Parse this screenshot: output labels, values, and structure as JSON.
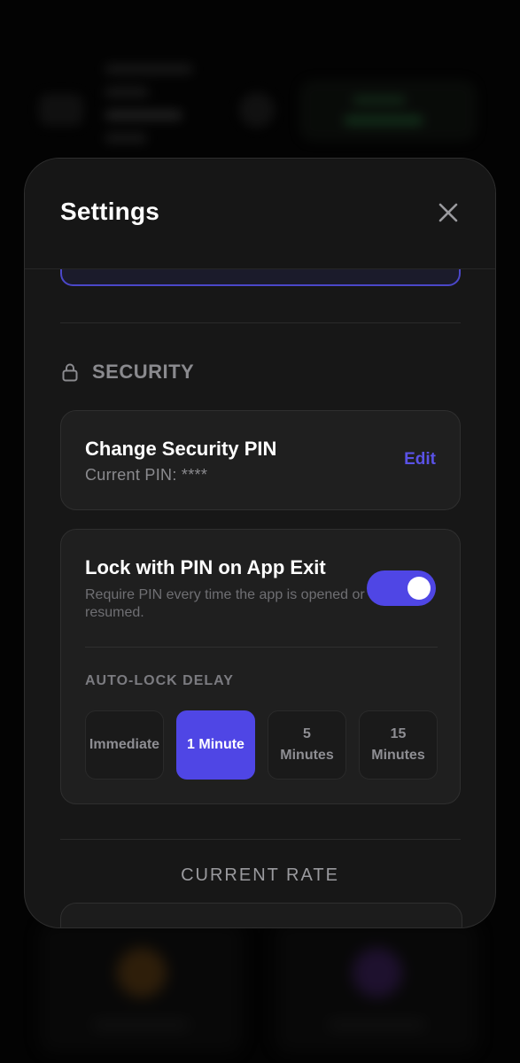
{
  "modal": {
    "title": "Settings"
  },
  "security": {
    "section_title": "SECURITY",
    "change_pin": {
      "title": "Change Security PIN",
      "current": "Current PIN: ****",
      "edit_label": "Edit"
    },
    "lock_on_exit": {
      "title": "Lock with PIN on App Exit",
      "description": "Require PIN every time the app is opened or resumed.",
      "enabled": true
    },
    "auto_lock": {
      "label": "AUTO-LOCK DELAY",
      "options": [
        {
          "line1": "Immediate",
          "line2": ""
        },
        {
          "line1": "1 Minute",
          "line2": ""
        },
        {
          "line1": "5",
          "line2": "Minutes"
        },
        {
          "line1": "15",
          "line2": "Minutes"
        }
      ],
      "selected": "1 Minute"
    }
  },
  "rate": {
    "section_title": "CURRENT RATE"
  },
  "colors": {
    "accent": "#4f46e5",
    "edit_link": "#5a52e6",
    "modal_bg": "#171717",
    "card_bg": "#1f1f1f"
  },
  "icons": {
    "close": "close-icon",
    "lock": "lock-icon"
  }
}
